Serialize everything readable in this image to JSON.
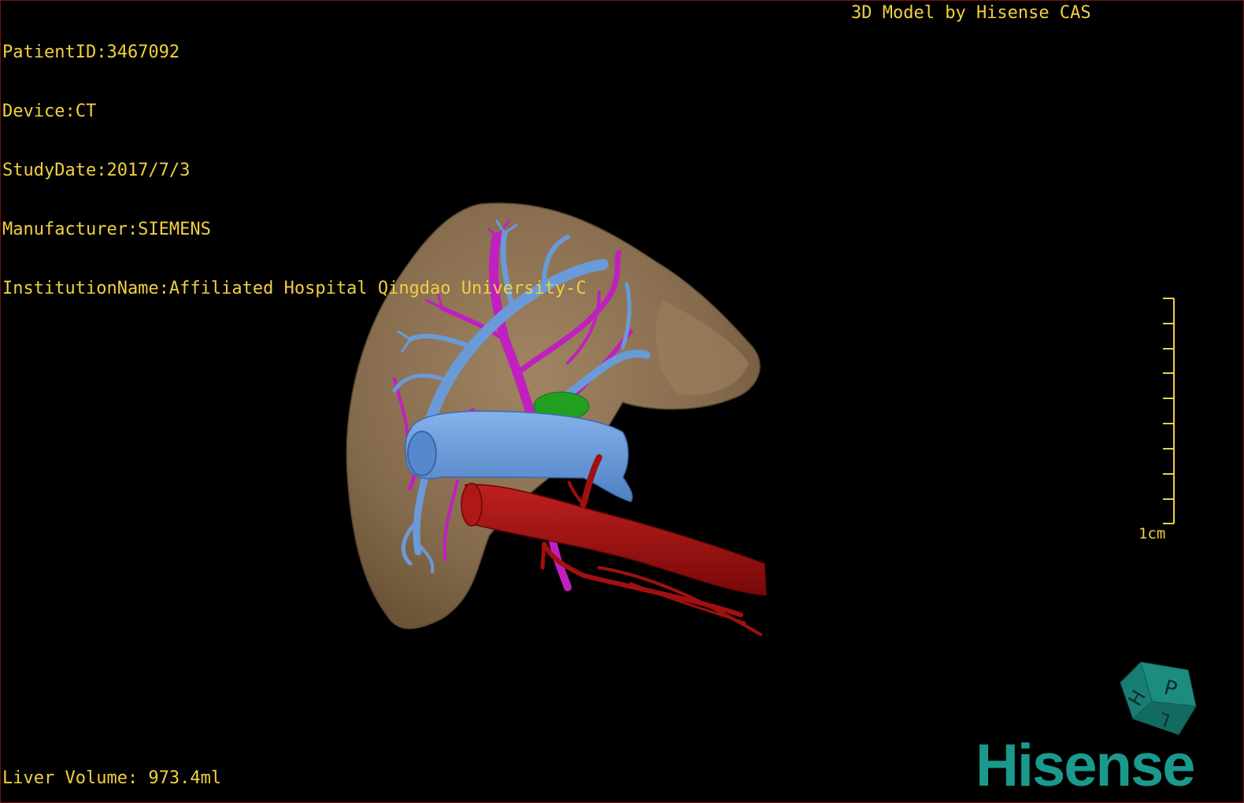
{
  "dicom": {
    "patient_id": "PatientID:3467092",
    "device": "Device:CT",
    "study_date": "StudyDate:2017/7/3",
    "manufacturer": "Manufacturer:SIEMENS",
    "institution": "InstitutionName:Affiliated Hospital Qingdao University-C"
  },
  "credit": "3D Model by Hisense CAS",
  "liver_volume": "Liver Volume: 973.4ml",
  "scale": {
    "label": "1cm"
  },
  "orientation_cube": {
    "face_labels": [
      "P",
      "H",
      "L"
    ]
  },
  "brand": "Hisense",
  "colors": {
    "overlay_text": "#f0d040",
    "liver": "#8a7050",
    "portal_vein": "#6a9ad8",
    "hepatic_vein": "#c020c0",
    "artery": "#a01010",
    "gallbladder": "#20a020",
    "brand": "#1a9a8c"
  }
}
